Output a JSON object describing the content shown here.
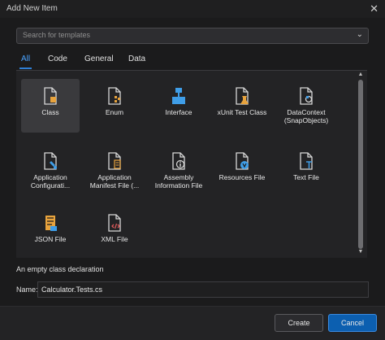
{
  "window": {
    "title": "Add New Item",
    "close_glyph": "✕"
  },
  "search": {
    "placeholder": "Search for templates",
    "dropdown_glyph": "⌄"
  },
  "tabs": [
    {
      "label": "All",
      "active": true
    },
    {
      "label": "Code",
      "active": false
    },
    {
      "label": "General",
      "active": false
    },
    {
      "label": "Data",
      "active": false
    }
  ],
  "items": [
    {
      "label": "Class",
      "icon": "class-file-icon",
      "selected": true
    },
    {
      "label": "Enum",
      "icon": "enum-file-icon"
    },
    {
      "label": "Interface",
      "icon": "interface-icon"
    },
    {
      "label": "xUnit Test Class",
      "icon": "test-class-icon"
    },
    {
      "label": "DataContext (SnapObjects)",
      "icon": "datacontext-icon"
    },
    {
      "label": "Application Configurati...",
      "icon": "app-config-icon"
    },
    {
      "label": "Application Manifest File (...",
      "icon": "manifest-file-icon"
    },
    {
      "label": "Assembly Information File",
      "icon": "assembly-info-icon"
    },
    {
      "label": "Resources File",
      "icon": "resources-file-icon"
    },
    {
      "label": "Text File",
      "icon": "text-file-icon"
    },
    {
      "label": "JSON File",
      "icon": "json-file-icon"
    },
    {
      "label": "XML File",
      "icon": "xml-file-icon"
    }
  ],
  "description": "An empty class declaration",
  "name_field": {
    "label": "Name:",
    "value": "Calculator.Tests.cs"
  },
  "buttons": {
    "create": "Create",
    "cancel": "Cancel"
  },
  "colors": {
    "accent": "#2f7fd5",
    "primary_button": "#0c5fb0",
    "background": "#1b1b1c"
  }
}
